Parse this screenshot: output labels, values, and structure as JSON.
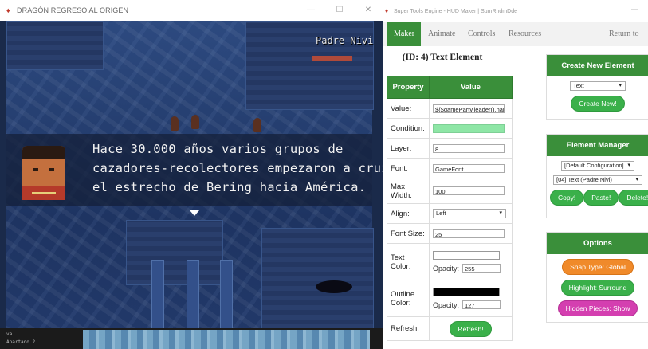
{
  "game_window": {
    "title": "DRAGÓN REGRESO AL ORIGEN",
    "controls": {
      "minimize": "—",
      "maximize": "☐",
      "close": "✕"
    },
    "speaker_name": "Padre Nivi",
    "message_lines": [
      "Hace 30.000 años varios grupos de",
      "cazadores-recolectores empezaron a cruzar",
      "el estrecho de Bering hacia América."
    ],
    "taskbar_lines": [
      "va",
      "Apartado 2"
    ]
  },
  "hud_window": {
    "title": "Super Tools Engine - HUD Maker | SumRndmDde",
    "minimize": "—",
    "nav": {
      "tabs": [
        "Maker",
        "Animate",
        "Controls",
        "Resources"
      ],
      "active": "Maker",
      "return_label": "Return to Ma"
    },
    "element_title": "(ID: 4) Text Element",
    "properties": {
      "header_property": "Property",
      "header_value": "Value",
      "rows": [
        {
          "key": "Value:",
          "value": "${$gameParty.leader().nam"
        },
        {
          "key": "Condition:",
          "value": ""
        },
        {
          "key": "Layer:",
          "value": "8"
        },
        {
          "key": "Font:",
          "value": "GameFont"
        },
        {
          "key": "Max Width:",
          "value": "100"
        },
        {
          "key": "Align:",
          "value": "Left"
        },
        {
          "key": "Font Size:",
          "value": "25"
        }
      ],
      "text_color": {
        "key": "Text Color:",
        "swatch": "#ffffff",
        "opacity_label": "Opacity:",
        "opacity": "255"
      },
      "outline_color": {
        "key": "Outline Color:",
        "swatch": "#000000",
        "opacity_label": "Opacity:",
        "opacity": "127"
      },
      "refresh": {
        "key": "Refresh:",
        "button": "Refresh!"
      }
    },
    "create_panel": {
      "title": "Create New Element",
      "type_value": "Text",
      "button": "Create New!"
    },
    "manager_panel": {
      "title": "Element Manager",
      "configuration": "[Default Configuration]",
      "element": "[04] Text (Padre Nivi)",
      "buttons": [
        "Copy!",
        "Paste!",
        "Delete!"
      ]
    },
    "options_panel": {
      "title": "Options",
      "snap": "Snap Type: Global",
      "highlight": "Highlight: Surround",
      "hidden": "Hidden Pieces: Show"
    }
  },
  "colors": {
    "accent_green": "#3a8f3a",
    "button_green": "#3ab04a",
    "orange": "#f08a2a",
    "pink": "#d43fb0",
    "condition_fill": "#8ee6a6"
  }
}
